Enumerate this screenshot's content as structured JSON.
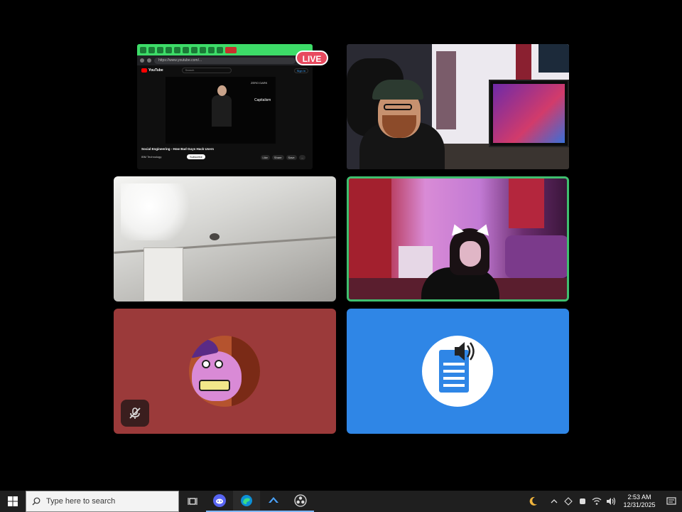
{
  "stream": {
    "live_badge": "LIVE"
  },
  "shared_screen": {
    "url": "https://www.youtube.com/...",
    "site_name": "YouTube",
    "search_placeholder": "Search",
    "sign_in": "Sign in",
    "video_overlay_1": "ZERO DARK",
    "video_overlay_2": "Capitalism",
    "video_title": "Social Engineering - How Bad Guys Hack Users",
    "channel": "IBM Technology",
    "subscribe_label": "Subscribe",
    "actions": [
      "Like",
      "Share",
      "Save",
      "..."
    ]
  },
  "participants": [
    {
      "id": "cam-1",
      "speaking": false
    },
    {
      "id": "cam-2",
      "speaking": false
    },
    {
      "id": "cam-3",
      "speaking": true,
      "border_color": "#3fbf6f"
    },
    {
      "id": "avatar",
      "muted": true,
      "tile_color": "#9b3a3a"
    },
    {
      "id": "text-to-speech",
      "tile_color": "#2f86e6"
    }
  ],
  "taskbar": {
    "search_placeholder": "Type here to search",
    "pinned": [
      "task-view-icon",
      "discord-icon",
      "edge-icon",
      "steam-icon",
      "obs-icon"
    ],
    "tray": [
      "weather-moon-icon",
      "chevron-up-icon",
      "network-icon",
      "volume-icon"
    ],
    "time": "2:53 AM",
    "date": "12/31/2025"
  }
}
